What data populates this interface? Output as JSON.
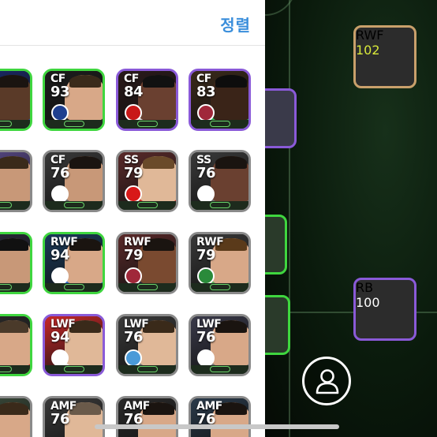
{
  "header": {
    "sort_label": "정렬"
  },
  "list": {
    "cards": [
      {
        "pos": "",
        "rating": "",
        "border": "#3fd63f",
        "bg": "#1a2a6a",
        "skin": "#5a3a28",
        "hair": "#1a1410",
        "shirt": "#2a4ba6",
        "badge": ""
      },
      {
        "pos": "CF",
        "rating": "93",
        "border": "#3fd63f",
        "bg": "#1c1c1c",
        "skin": "#d8a888",
        "hair": "#3a2a1a",
        "shirt": "#2a2a2a",
        "badge": "#1f3f8f"
      },
      {
        "pos": "CF",
        "rating": "84",
        "border": "#8a5ad8",
        "bg": "#2a1a1a",
        "skin": "#6a4030",
        "hair": "#111111",
        "shirt": "#d8d8d8",
        "badge": "#c81818"
      },
      {
        "pos": "CF",
        "rating": "83",
        "border": "#8a5ad8",
        "bg": "#3a2a1a",
        "skin": "#3a2418",
        "hair": "#0d0d0d",
        "shirt": "#2fb85a",
        "badge": "#a0283a"
      },
      {
        "pos": "",
        "rating": "",
        "border": "#8a8a8a",
        "bg": "#5a4a8a",
        "skin": "#c89878",
        "hair": "#3a2a1a",
        "shirt": "#7a7a7a",
        "badge": ""
      },
      {
        "pos": "CF",
        "rating": "76",
        "border": "#8a8a8a",
        "bg": "#3a3a3a",
        "skin": "#c89878",
        "hair": "#1a1410",
        "shirt": "#6a6a6a",
        "badge": "#ffffff"
      },
      {
        "pos": "SS",
        "rating": "79",
        "border": "#8a8a8a",
        "bg": "#5a2a2a",
        "skin": "#e0b898",
        "hair": "#6a4a2a",
        "shirt": "#c82828",
        "badge": "#d81818"
      },
      {
        "pos": "SS",
        "rating": "76",
        "border": "#8a8a8a",
        "bg": "#3a3a3a",
        "skin": "#6a4030",
        "hair": "#1a1410",
        "shirt": "#6a6a6a",
        "badge": "#ffffff"
      },
      {
        "pos": "",
        "rating": "",
        "border": "#3fd63f",
        "bg": "#2a2a3a",
        "skin": "#c89878",
        "hair": "#111111",
        "shirt": "#1a1a1a",
        "badge": ""
      },
      {
        "pos": "RWF",
        "rating": "94",
        "border": "#3fd63f",
        "bg": "#1a3a5a",
        "skin": "#d8a888",
        "hair": "#1a1410",
        "shirt": "#2a6ac8",
        "badge": "#ffffff"
      },
      {
        "pos": "RWF",
        "rating": "79",
        "border": "#8a8a8a",
        "bg": "#5a2a2a",
        "skin": "#7a4a30",
        "hair": "#1a1410",
        "shirt": "#2a2a3a",
        "badge": "#a0283a"
      },
      {
        "pos": "RWF",
        "rating": "79",
        "border": "#8a8a8a",
        "bg": "#3a3a3a",
        "skin": "#d8a888",
        "hair": "#5a3a1a",
        "shirt": "#5aa85a",
        "badge": "#2a8a3a"
      },
      {
        "pos": "",
        "rating": "",
        "border": "#3fd63f",
        "bg": "#2a2a2a",
        "skin": "#d8a888",
        "hair": "#4a3a2a",
        "shirt": "#c82828",
        "badge": ""
      },
      {
        "pos": "LWF",
        "rating": "94",
        "border": "#8a5ad8",
        "bg": "#c82828",
        "skin": "#e0b898",
        "hair": "#3a2a1a",
        "shirt": "#f0f0f0",
        "badge": "#ffffff"
      },
      {
        "pos": "LWF",
        "rating": "76",
        "border": "#8a8a8a",
        "bg": "#3a3a3a",
        "skin": "#e0b898",
        "hair": "#3a2a1a",
        "shirt": "#7a7a7a",
        "badge": "#4a9ad8"
      },
      {
        "pos": "LWF",
        "rating": "76",
        "border": "#8a8a8a",
        "bg": "#3a3a4a",
        "skin": "#d8a888",
        "hair": "#1a1410",
        "shirt": "#7a7a7a",
        "badge": "#ffffff"
      },
      {
        "pos": "",
        "rating": "",
        "border": "#8a8a8a",
        "bg": "#3a4a3a",
        "skin": "#d8a888",
        "hair": "#3a2a1a",
        "shirt": "#3a8a3a",
        "badge": ""
      },
      {
        "pos": "AMF",
        "rating": "76",
        "border": "#8a8a8a",
        "bg": "#3a3a3a",
        "skin": "#e0b898",
        "hair": "#6a5a4a",
        "shirt": "#5a5a5a",
        "badge": ""
      },
      {
        "pos": "AMF",
        "rating": "76",
        "border": "#8a8a8a",
        "bg": "#2a2a2a",
        "skin": "#d8a888",
        "hair": "#1a1410",
        "shirt": "#c82828",
        "badge": ""
      },
      {
        "pos": "AMF",
        "rating": "76",
        "border": "#8a8a8a",
        "bg": "#2a3a4a",
        "skin": "#d8a888",
        "hair": "#1a1410",
        "shirt": "#2a8ac8",
        "badge": ""
      }
    ]
  },
  "pitch": {
    "cards": [
      {
        "pos": "RWF",
        "rating": "102",
        "border": "#c9a06b",
        "bg": "#4a7a4a",
        "skin": "#c89878",
        "hair": "#1a1410",
        "shirt": "#2a3a8a",
        "badge": "#a0283a",
        "rating_color": "#d8e83a"
      },
      {
        "pos": "RB",
        "rating": "100",
        "border": "#8a5ad8",
        "bg": "#3a2a5a",
        "skin": "#6a4030",
        "hair": "#111111",
        "shirt": "#2a2a3a",
        "badge": "#a0283a",
        "rating_color": "#ffffff"
      }
    ]
  },
  "profile": {
    "icon": "person-icon"
  }
}
